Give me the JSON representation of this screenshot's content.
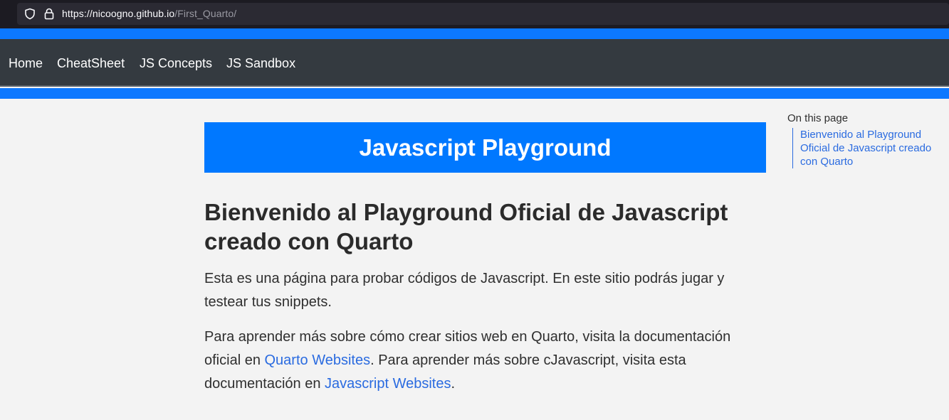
{
  "browser": {
    "url_host": "https://nicoogno.github.io",
    "url_path": "/First_Quarto/"
  },
  "navbar": {
    "items": [
      {
        "label": "Home"
      },
      {
        "label": "CheatSheet"
      },
      {
        "label": "JS Concepts"
      },
      {
        "label": "JS Sandbox"
      }
    ]
  },
  "banner": {
    "title": "Javascript Playground"
  },
  "main": {
    "heading": "Bienvenido al Playground Oficial de Javascript creado con Quarto",
    "paragraph1": "Esta es una página para probar códigos de Javascript. En este sitio podrás jugar y testear tus snippets.",
    "paragraph2_part1": "Para aprender más sobre cómo crear sitios web en Quarto, visita la documentación oficial en ",
    "link1": "Quarto Websites",
    "paragraph2_part2": ". Para aprender más sobre cJavascript, visita esta documentación en ",
    "link2": "Javascript Websites",
    "paragraph2_part3": "."
  },
  "toc": {
    "title": "On this page",
    "items": [
      {
        "label": "Bienvenido al Playground Oficial de Javascript creado con Quarto"
      }
    ]
  },
  "colors": {
    "accent": "#0d78ff",
    "navbar_bg": "#343a40",
    "link": "#2a6be0"
  }
}
